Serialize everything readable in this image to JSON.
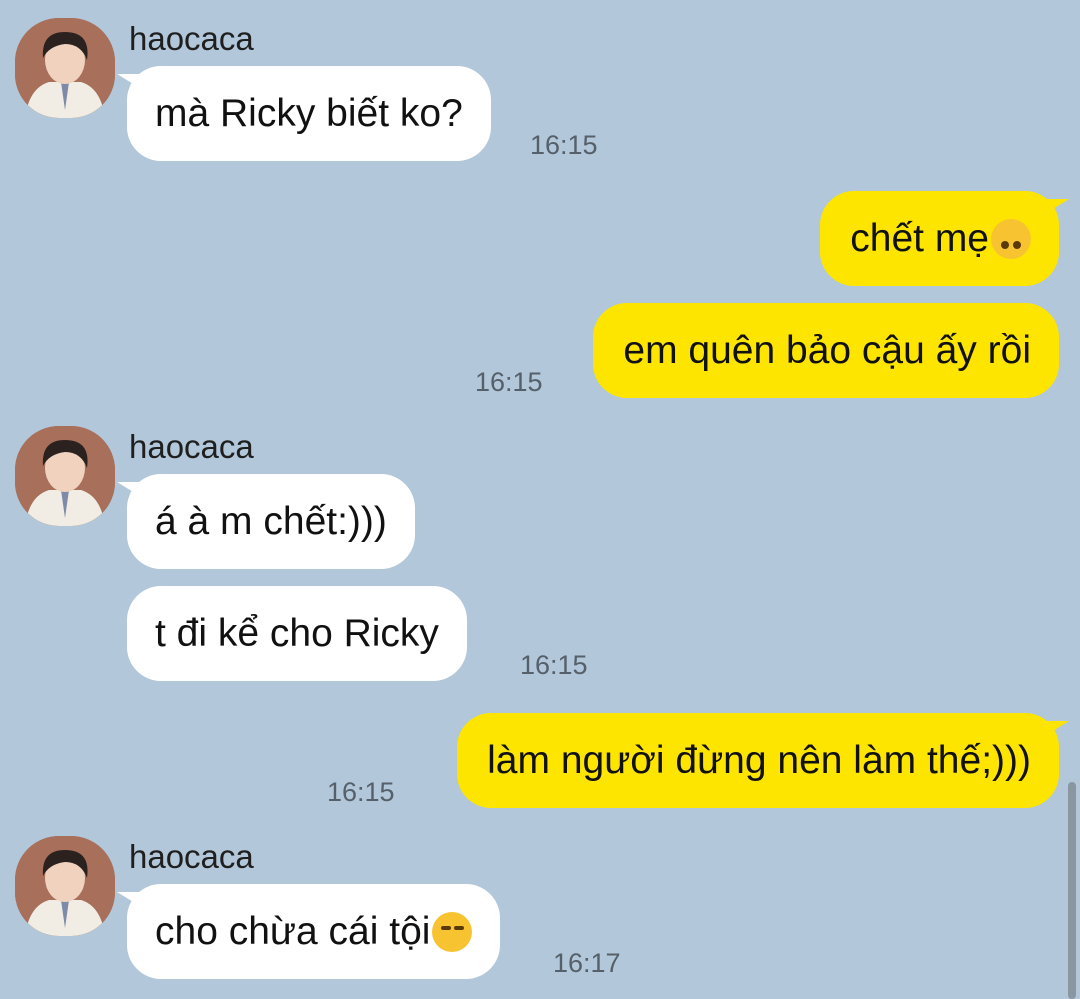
{
  "chat": {
    "group1": {
      "sender": "haocaca",
      "msg1": "mà Ricky biết ko?",
      "time": "16:15"
    },
    "group2": {
      "msg1_text": "chết mẹ",
      "msg1_emoji": "upside-down-face-emoji",
      "msg2": "em quên bảo cậu ấy rồi",
      "time": "16:15"
    },
    "group3": {
      "sender": "haocaca",
      "msg1": "á à m chết:)))",
      "msg2": "t đi kể cho Ricky",
      "time": "16:15"
    },
    "group4": {
      "msg1": "làm người đừng nên làm thế;)))",
      "time": "16:15"
    },
    "group5": {
      "sender": "haocaca",
      "msg1_text": "cho chừa cái tội",
      "msg1_emoji": "unamused-face-emoji",
      "time": "16:17"
    }
  },
  "colors": {
    "background": "#b2c7d9",
    "incoming_bubble": "#ffffff",
    "outgoing_bubble": "#fee500",
    "timestamp": "#55606a"
  }
}
